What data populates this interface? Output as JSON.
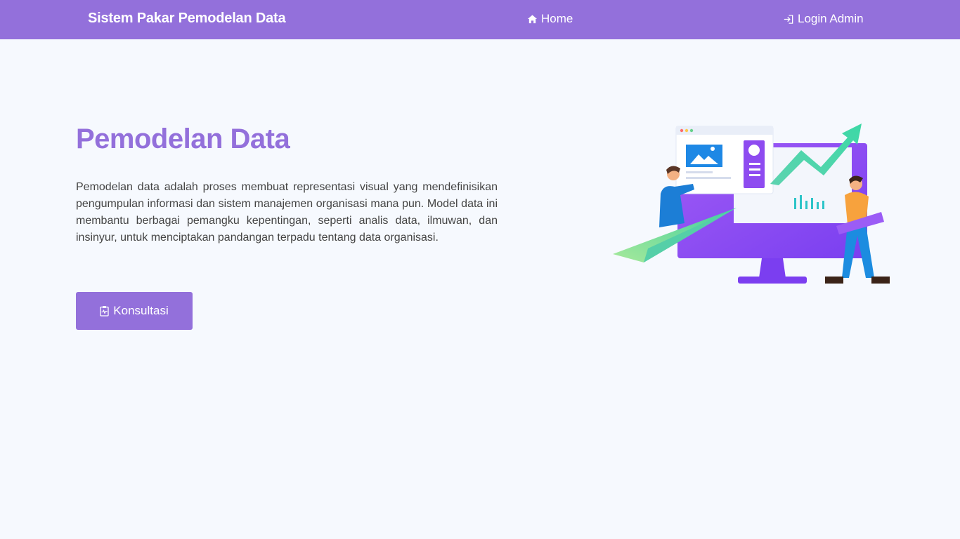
{
  "navbar": {
    "brand": "Sistem Pakar Pemodelan Data",
    "links": [
      {
        "label": "Home",
        "icon": "house-icon"
      },
      {
        "label": "Login Admin",
        "icon": "login-icon"
      }
    ]
  },
  "hero": {
    "title": "Pemodelan Data",
    "description": "Pemodelan data adalah proses membuat representasi visual yang mendefinisikan pengumpulan informasi dan sistem manajemen organisasi mana pun. Model data ini membantu berbagai pemangku kepentingan, seperti analis data, ilmuwan, dan insinyur, untuk menciptakan pandangan terpadu tentang data organisasi.",
    "button_label": "Konsultasi",
    "button_icon": "clipboard-pulse-icon"
  },
  "colors": {
    "primary": "#9370db",
    "background": "#f6f9fe",
    "text": "#444444"
  }
}
